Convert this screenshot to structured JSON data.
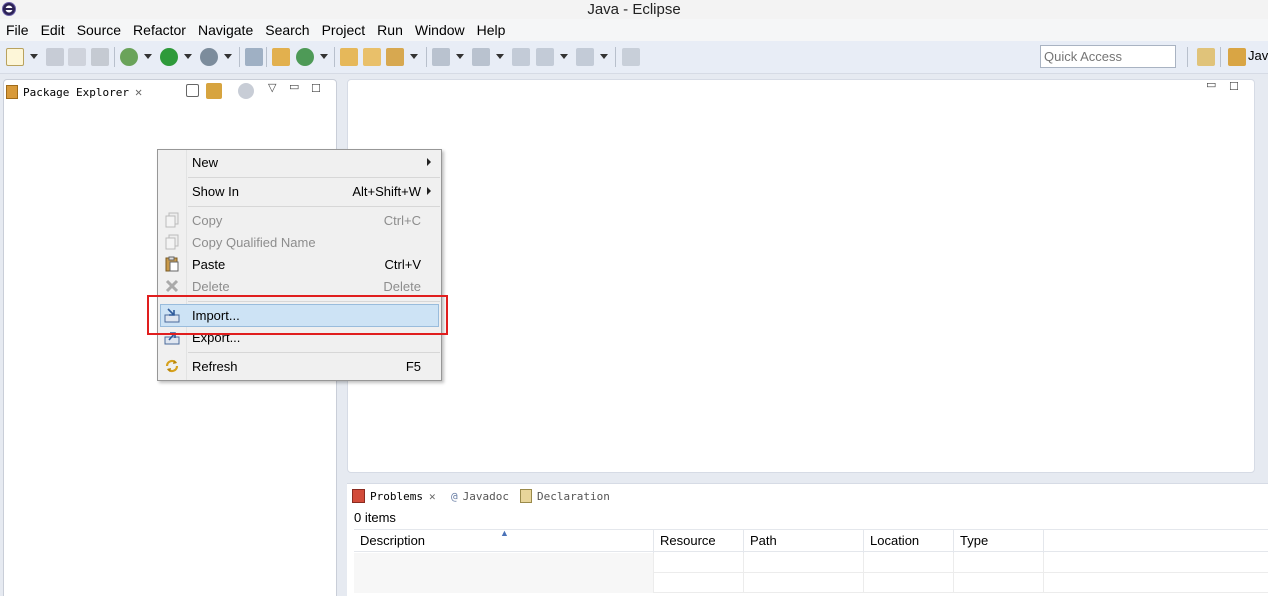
{
  "window": {
    "title": "Java - Eclipse"
  },
  "menubar": [
    "File",
    "Edit",
    "Source",
    "Refactor",
    "Navigate",
    "Search",
    "Project",
    "Run",
    "Window",
    "Help"
  ],
  "toolbar": {
    "quick_access_placeholder": "Quick Access",
    "perspective_label": "Java"
  },
  "package_explorer": {
    "tab_label": "Package Explorer"
  },
  "context_menu": {
    "items": [
      {
        "label": "New",
        "shortcut": "",
        "submenu": true,
        "enabled": true,
        "icon": ""
      },
      {
        "label": "Show In",
        "shortcut": "Alt+Shift+W",
        "submenu": true,
        "enabled": true,
        "icon": ""
      },
      {
        "label": "Copy",
        "shortcut": "Ctrl+C",
        "submenu": false,
        "enabled": false,
        "icon": "copy-icon"
      },
      {
        "label": "Copy Qualified Name",
        "shortcut": "",
        "submenu": false,
        "enabled": false,
        "icon": "copy-qualified-icon"
      },
      {
        "label": "Paste",
        "shortcut": "Ctrl+V",
        "submenu": false,
        "enabled": true,
        "icon": "paste-icon"
      },
      {
        "label": "Delete",
        "shortcut": "Delete",
        "submenu": false,
        "enabled": false,
        "icon": "delete-icon"
      },
      {
        "label": "Import...",
        "shortcut": "",
        "submenu": false,
        "enabled": true,
        "icon": "import-icon",
        "highlighted": true
      },
      {
        "label": "Export...",
        "shortcut": "",
        "submenu": false,
        "enabled": true,
        "icon": "export-icon"
      },
      {
        "label": "Refresh",
        "shortcut": "F5",
        "submenu": false,
        "enabled": true,
        "icon": "refresh-icon"
      }
    ]
  },
  "bottom_panel": {
    "tabs": [
      "Problems",
      "Javadoc",
      "Declaration"
    ],
    "active_tab": "Problems",
    "items_count": "0 items",
    "columns": [
      "Description",
      "Resource",
      "Path",
      "Location",
      "Type"
    ]
  },
  "colors": {
    "highlight": "#cde3f5",
    "annotation_box": "#e01e1e"
  }
}
